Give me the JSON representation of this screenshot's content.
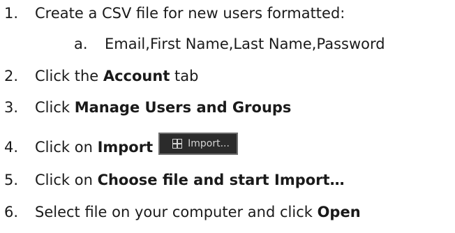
{
  "steps": [
    {
      "num": "1.",
      "text": "Create a CSV file for new users formatted:"
    },
    {
      "num": "2.",
      "pre": "Click the ",
      "bold": "Account",
      "post": " tab"
    },
    {
      "num": "3.",
      "pre": "Click ",
      "bold": "Manage Users and Groups"
    },
    {
      "num": "4.",
      "pre": "Click on ",
      "bold": "Import"
    },
    {
      "num": "5.",
      "pre": "Click on ",
      "bold": "Choose file and start Import…"
    },
    {
      "num": "6.",
      "pre": "Select file on your computer and click ",
      "bold": "Open"
    }
  ],
  "substep": {
    "letter": "a.",
    "text": "Email,First Name,Last Name,Password"
  },
  "import_button": {
    "label": "Import...",
    "icon": "grid-icon"
  }
}
